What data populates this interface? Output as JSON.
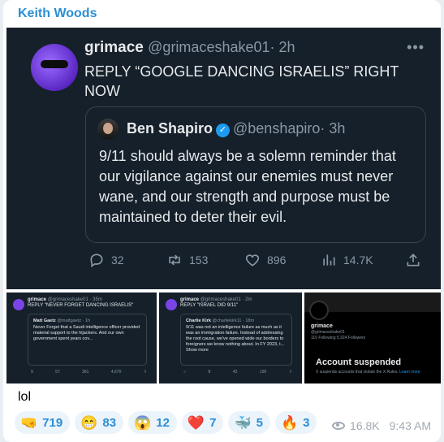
{
  "sender": "Keith Woods",
  "tweet": {
    "name": "grimace",
    "handle": "@grimaceshake01",
    "time": "· 2h",
    "text": "REPLY “GOOGLE DANCING ISRAELIS” RIGHT NOW",
    "quote": {
      "name": "Ben Shapiro",
      "handle": "@benshapiro",
      "time": "· 3h",
      "text": "9/11 should always be a solemn reminder that our vigilance against our enemies must never wane, and our strength and purpose must be maintained to deter their evil."
    },
    "replies": "32",
    "retweets": "153",
    "likes": "896",
    "views": "14.7K"
  },
  "thumbs": [
    {
      "name": "grimace",
      "handle": "@grimaceshake01 · 35m",
      "text": "REPLY \"NEVER FORGET DANCING ISRAELIS\"",
      "qname": "Matt Gaetz",
      "qhandle": "@mattgaetz · 1h",
      "qtext": "Never Forget that a Saudi intelligence officer provided material support to the hijackers. And our own government spent years cov...",
      "replies": "9",
      "retweets": "57",
      "likes": "361",
      "views": "4,670"
    },
    {
      "name": "grimace",
      "handle": "@grimaceshake01 · 2m",
      "text": "REPLY \"ISRAEL DID 9/11\"",
      "qname": "Charlie Kirk",
      "qhandle": "@charliekirk11 · 18m",
      "qtext": "9/11 was not an intelligence failure as much as it was an immigration failure. Instead of addressing the root cause, we've opened wide our borders to foreigners we know nothing about. In FY 2023, t... Show more",
      "replies": "",
      "retweets": "8",
      "likes": "42",
      "views": "190"
    },
    {
      "name": "grimace",
      "handle": "@grimaceshake01",
      "follow": "110 Following  5,324 Followers",
      "title": "Account suspended",
      "desc": "X suspends accounts that violate the X Rules.",
      "link": "Learn more"
    }
  ],
  "caption": "lol",
  "reactions": [
    {
      "emoji": "🤜",
      "count": "719"
    },
    {
      "emoji": "😁",
      "count": "83"
    },
    {
      "emoji": "😱",
      "count": "12"
    },
    {
      "emoji": "❤️",
      "count": "7"
    },
    {
      "emoji": "🐳",
      "count": "5"
    },
    {
      "emoji": "🔥",
      "count": "3"
    }
  ],
  "views": "16.8K",
  "time": "9:43 AM",
  "colors": {
    "accent": "#2a8fd6",
    "tweet_bg": "#15202b",
    "verified": "#1d9bf0"
  }
}
